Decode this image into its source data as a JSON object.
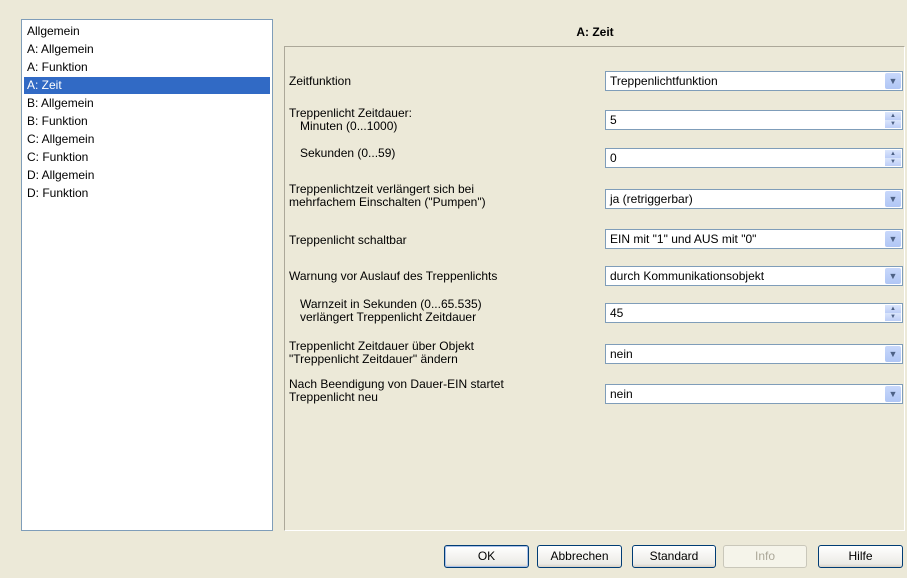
{
  "nav": {
    "items": [
      "Allgemein",
      "A: Allgemein",
      "A: Funktion",
      "A: Zeit",
      "B: Allgemein",
      "B: Funktion",
      "C: Allgemein",
      "C: Funktion",
      "D: Allgemein",
      "D: Funktion"
    ],
    "selected": "A: Zeit"
  },
  "page": {
    "title": "A: Zeit"
  },
  "params": {
    "zeitfunktion": {
      "label": "Zeitfunktion",
      "value": "Treppenlichtfunktion"
    },
    "dauer": {
      "label": "Treppenlicht Zeitdauer:",
      "minuten_label": "Minuten (0...1000)",
      "minuten_value": "5",
      "sekunden_label": "Sekunden (0...59)",
      "sekunden_value": "0"
    },
    "pumpen": {
      "label_line1": "Treppenlichtzeit verlängert sich bei",
      "label_line2": "mehrfachem Einschalten (\"Pumpen\")",
      "value": "ja (retriggerbar)"
    },
    "schaltbar": {
      "label": "Treppenlicht schaltbar",
      "value": "EIN mit \"1\" und AUS mit \"0\""
    },
    "warnung": {
      "label": "Warnung vor Auslauf des Treppenlichts",
      "value": "durch Kommunikationsobjekt"
    },
    "warnzeit": {
      "label_line1": "Warnzeit in Sekunden (0...65.535)",
      "label_line2": "verlängert Treppenlicht Zeitdauer",
      "value": "45"
    },
    "objekt": {
      "label_line1": "Treppenlicht Zeitdauer über Objekt",
      "label_line2": "\"Treppenlicht Zeitdauer\" ändern",
      "value": "nein"
    },
    "dauerein": {
      "label_line1": "Nach Beendigung von Dauer-EIN startet",
      "label_line2": "Treppenlicht neu",
      "value": "nein"
    }
  },
  "buttons": {
    "ok": "OK",
    "abbrechen": "Abbrechen",
    "standard": "Standard",
    "info": "Info",
    "hilfe": "Hilfe"
  },
  "icons": {
    "dropdown": "chevron-down-icon",
    "spinner": "spinner-arrows-icon"
  },
  "colors": {
    "selection": "#316ac5",
    "background": "#ece9d8"
  }
}
